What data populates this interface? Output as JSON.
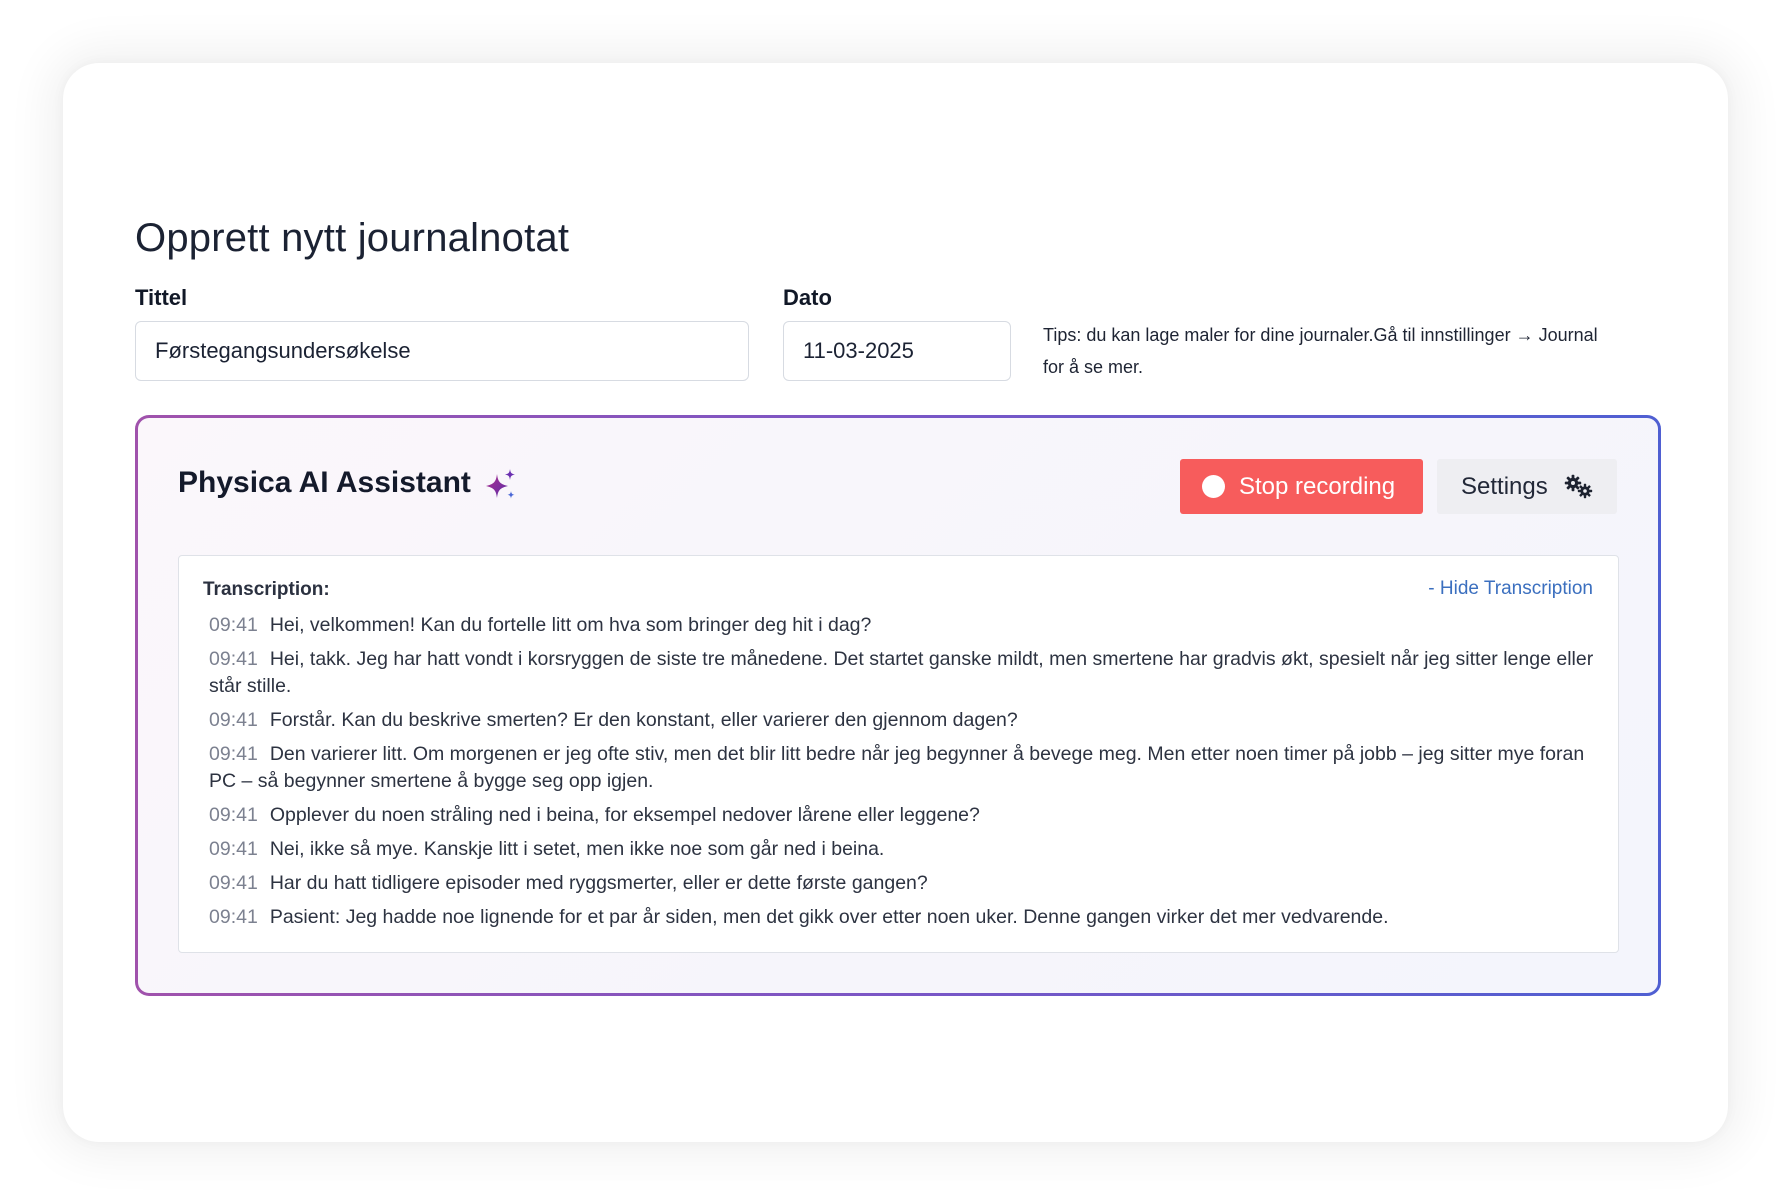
{
  "page": {
    "title": "Opprett nytt journalnotat"
  },
  "form": {
    "title_label": "Tittel",
    "title_value": "Førstegangsundersøkelse",
    "date_label": "Dato",
    "date_value": "11-03-2025",
    "tips": "Tips: du kan lage maler for dine journaler.Gå til innstillinger → Journal for å se mer."
  },
  "assistant": {
    "title": "Physica AI Assistant",
    "title_icon": "sparkle-icon",
    "stop_label": "Stop recording",
    "stop_color": "#f75c5c",
    "settings_label": "Settings",
    "settings_icon": "gears-icon",
    "border_gradient": [
      "#a052ac",
      "#4f5fd2"
    ]
  },
  "transcription": {
    "label": "Transcription:",
    "hide_label": "- Hide Transcription",
    "lines": [
      {
        "time": "09:41",
        "text": "Hei, velkommen! Kan du fortelle litt om hva som bringer deg hit i dag?"
      },
      {
        "time": "09:41",
        "text": "Hei, takk. Jeg har hatt vondt i korsryggen de siste tre månedene. Det startet ganske mildt, men smertene har gradvis økt, spesielt når jeg sitter lenge eller står stille."
      },
      {
        "time": "09:41",
        "text": "Forstår. Kan du beskrive smerten? Er den konstant, eller varierer den gjennom dagen?"
      },
      {
        "time": "09:41",
        "text": "Den varierer litt. Om morgenen er jeg ofte stiv, men det blir litt bedre når jeg begynner å bevege meg. Men etter noen timer på jobb – jeg sitter mye foran PC – så begynner smertene å bygge seg opp igjen."
      },
      {
        "time": "09:41",
        "text": "Opplever du noen stråling ned i beina, for eksempel nedover lårene eller leggene?"
      },
      {
        "time": "09:41",
        "text": "Nei, ikke så mye. Kanskje litt i setet, men ikke noe som går ned i beina."
      },
      {
        "time": "09:41",
        "text": "Har du hatt tidligere episoder med ryggsmerter, eller er dette første gangen?"
      },
      {
        "time": "09:41",
        "text": "Pasient: Jeg hadde noe lignende for et par år siden, men det gikk over etter noen uker. Denne gangen virker det mer vedvarende."
      }
    ]
  }
}
